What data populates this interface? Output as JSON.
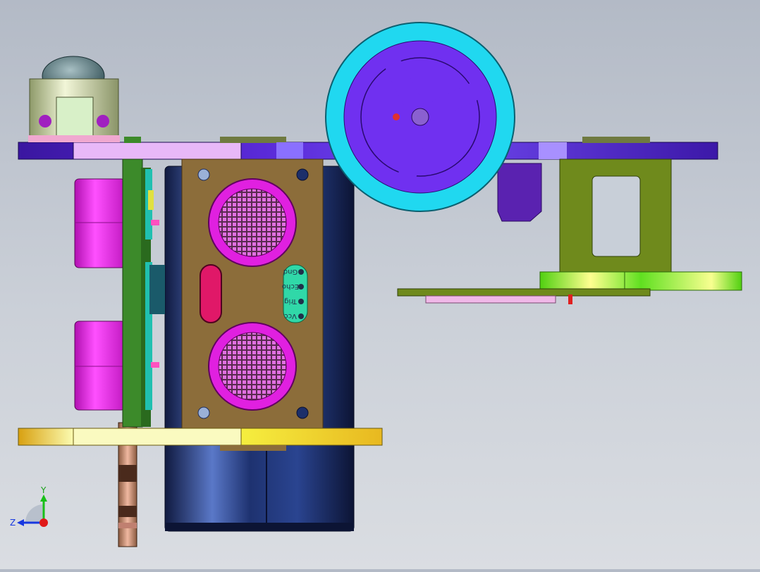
{
  "viewport": {
    "background_top": "#b3bac6",
    "background_bottom": "#dadde2"
  },
  "triad": {
    "y_label": "Y",
    "z_label": "Z",
    "x_axis_color": "#e01818",
    "y_axis_color": "#18c018",
    "z_axis_color": "#1838e0"
  },
  "sensor": {
    "pin_labels": [
      "Vcc",
      "Trig",
      "Echo",
      "Gnd"
    ]
  },
  "colors": {
    "top_plate": "#5a2ad8",
    "bottom_plate": "#f2f27a",
    "wheel_tire": "#20d8f0",
    "wheel_hub": "#7030f0",
    "sensor_board": "#8c6d3a",
    "transducer": "#e020e0",
    "battery": "#1c2f6a",
    "bracket": "#6f8a1c",
    "pcb": "#3c8a2a"
  }
}
